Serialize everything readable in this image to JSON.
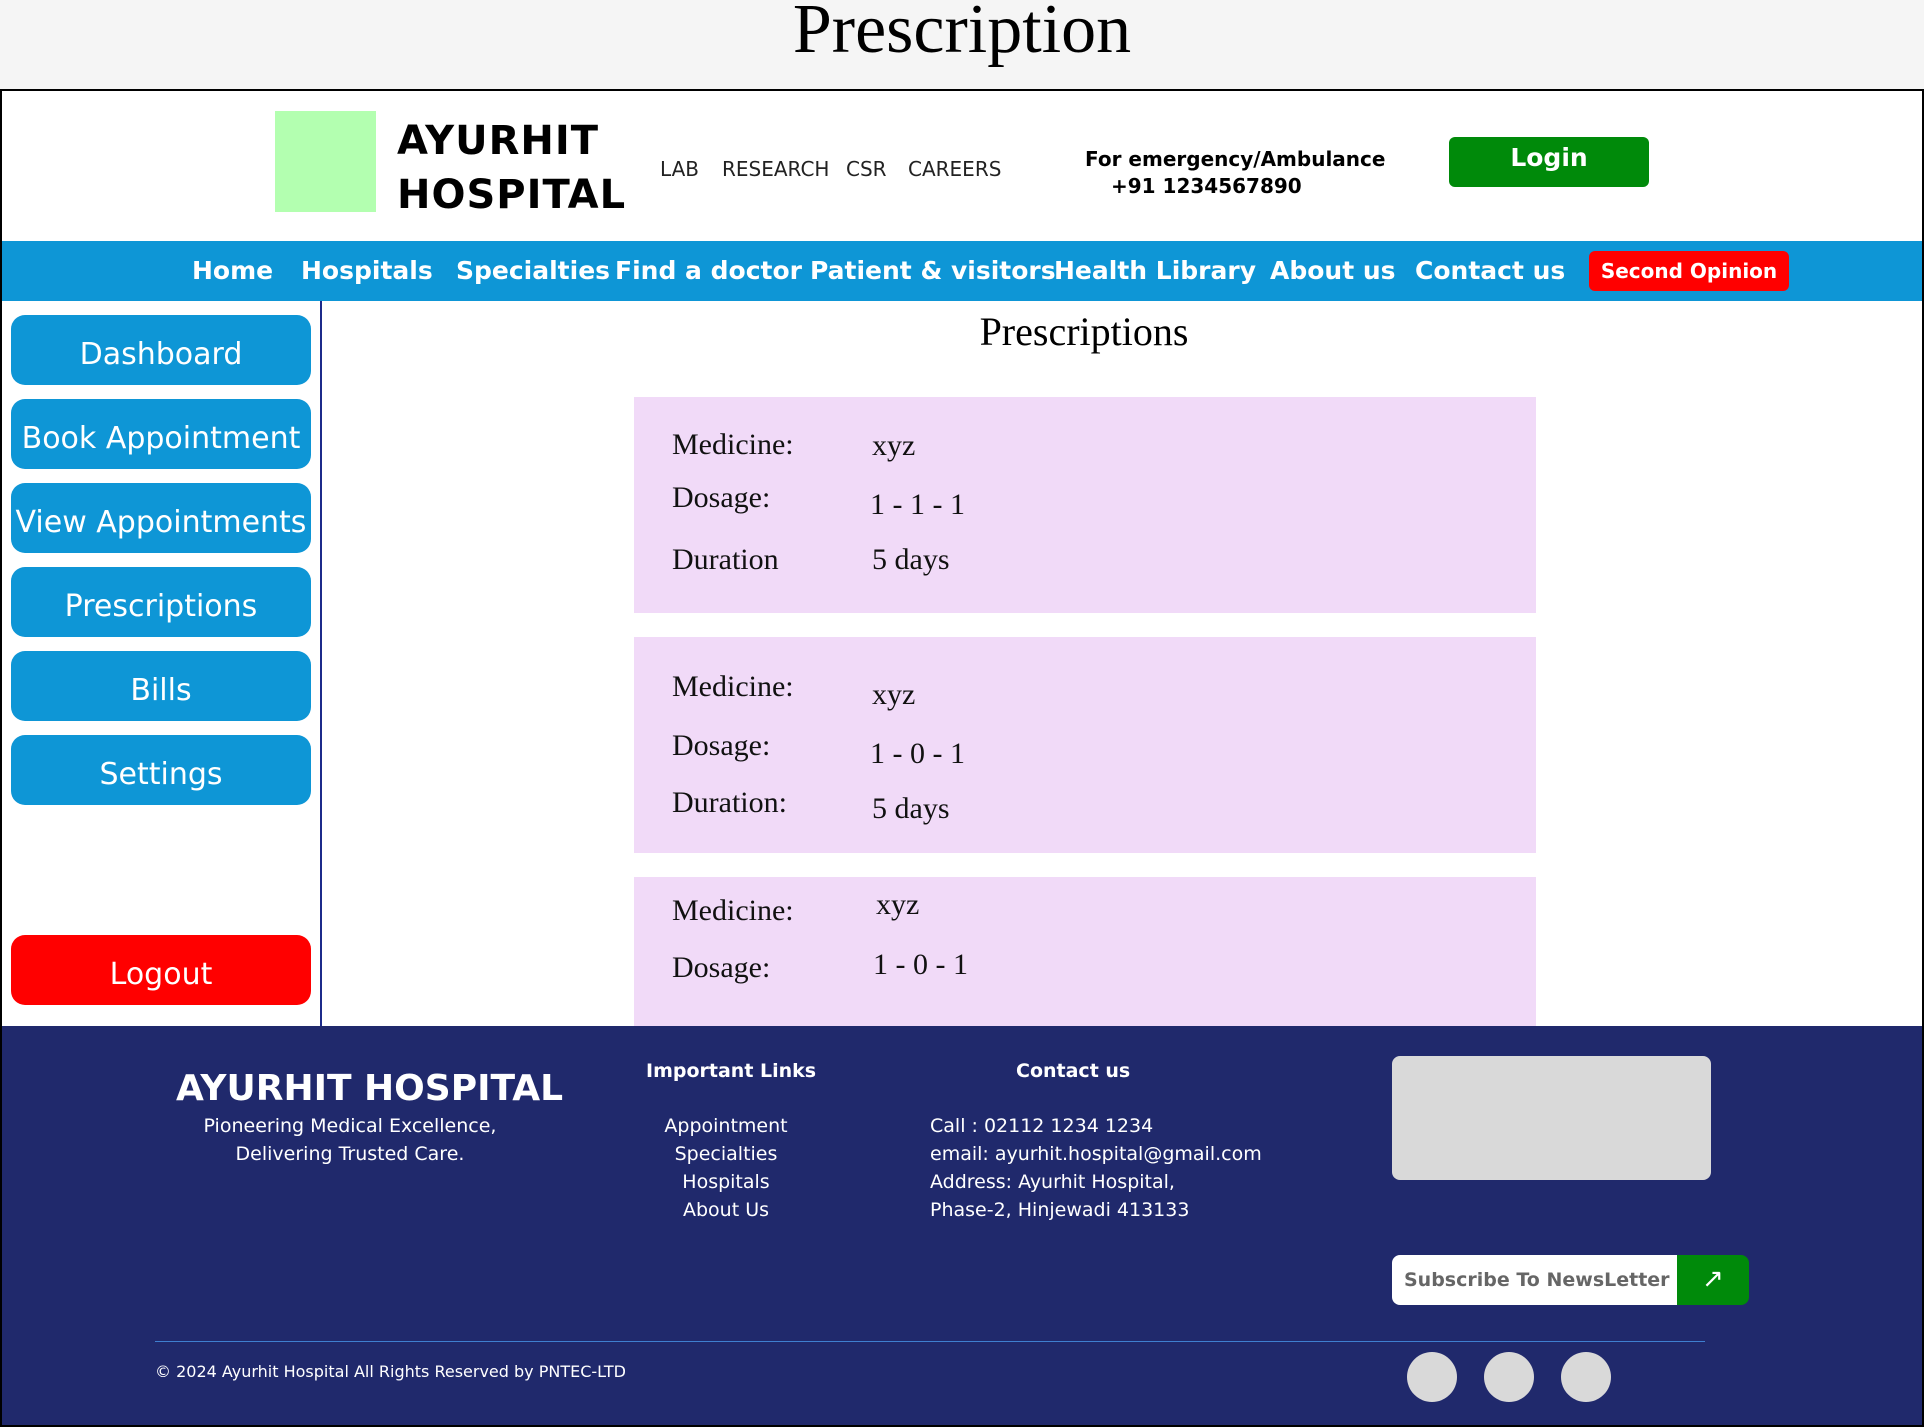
{
  "page_caption": "Prescription",
  "header": {
    "brand_line1": "AYURHIT",
    "brand_line2": "HOSPITAL",
    "top_links": [
      "LAB",
      "RESEARCH",
      "CSR",
      "CAREERS"
    ],
    "emergency_label": "For emergency/Ambulance",
    "emergency_phone": "+91 1234567890",
    "login_label": "Login"
  },
  "nav": {
    "items": [
      "Home",
      "Hospitals",
      "Specialties",
      "Find a doctor",
      "Patient & visitors",
      "Health Library",
      "About us",
      "Contact us"
    ],
    "second_opinion": "Second Opinion"
  },
  "sidebar": {
    "items": [
      "Dashboard",
      "Book Appointment",
      "View Appointments",
      "Prescriptions",
      "Bills",
      "Settings"
    ],
    "logout": "Logout"
  },
  "content": {
    "title": "Prescriptions",
    "prescriptions": [
      {
        "medicine_label": "Medicine:",
        "medicine": "xyz",
        "dosage_label": "Dosage:",
        "dosage": "1 - 1 - 1",
        "duration_label": "Duration",
        "duration": "5 days"
      },
      {
        "medicine_label": "Medicine:",
        "medicine": "xyz",
        "dosage_label": "Dosage:",
        "dosage": "1 - 0 - 1",
        "duration_label": "Duration:",
        "duration": "5 days"
      },
      {
        "medicine_label": "Medicine:",
        "medicine": "xyz",
        "dosage_label": "Dosage:",
        "dosage": "1 - 0 - 1"
      }
    ]
  },
  "footer": {
    "brand": "AYURHIT HOSPITAL",
    "tagline_1": "Pioneering Medical Excellence,",
    "tagline_2": "Delivering Trusted Care.",
    "links_heading": "Important Links",
    "links": [
      "Appointment",
      "Specialties",
      "Hospitals",
      "About Us"
    ],
    "contact_heading": "Contact us",
    "contact_lines": [
      "Call : 02112 1234 1234",
      "email: ayurhit.hospital@gmail.com",
      "Address: Ayurhit Hospital,",
      "Phase-2, Hinjewadi 413133"
    ],
    "newsletter_placeholder": "Subscribe To NewsLetter",
    "newsletter_button": "↗",
    "copyright": "© 2024 Ayurhit Hospital All Rights Reserved by PNTEC-LTD"
  },
  "colors": {
    "nav_blue": "#0e96d6",
    "login_green": "#008a0a",
    "alert_red": "#ff0000",
    "card_lilac": "#f1daf8",
    "footer_navy": "#20296c",
    "logo_green": "#b3ffb0"
  }
}
